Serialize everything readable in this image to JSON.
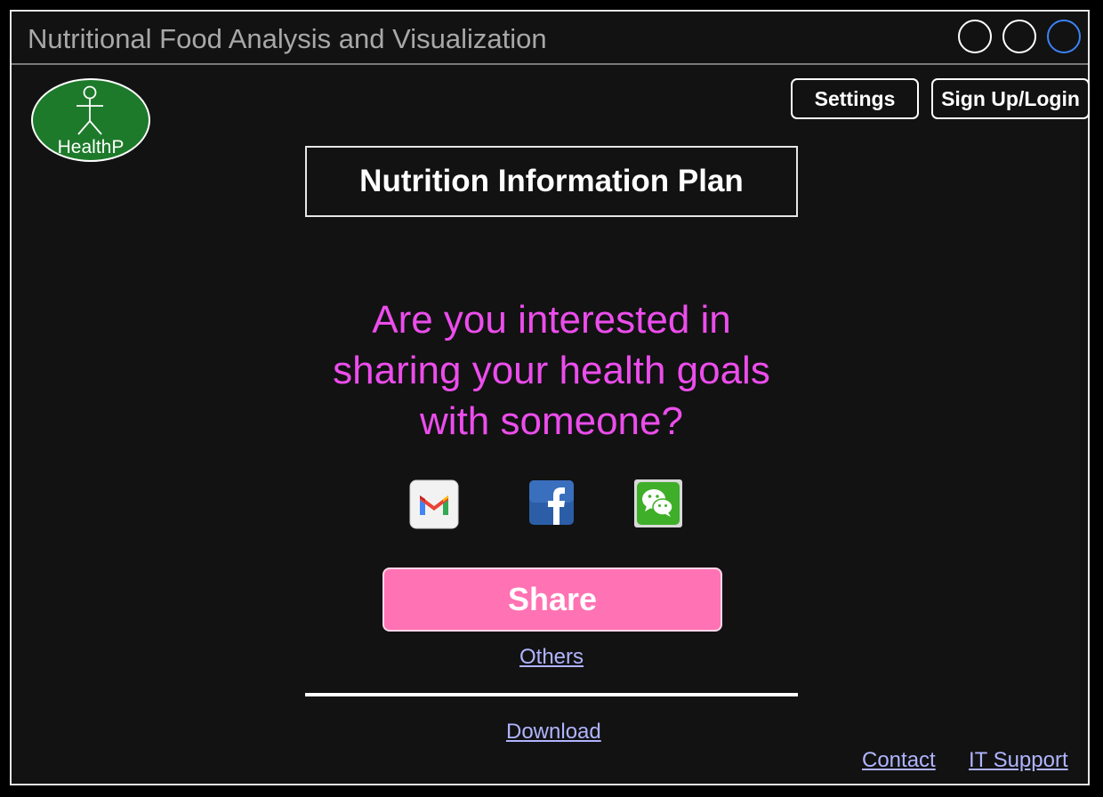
{
  "window": {
    "title": "Nutritional Food Analysis and Visualization",
    "controls": [
      "minimize",
      "maximize",
      "close"
    ]
  },
  "logo": {
    "text": "HealthP",
    "color": "#1d7a2a"
  },
  "header": {
    "settings_label": "Settings",
    "login_label": "Sign Up/Login"
  },
  "main": {
    "plan_title": "Nutrition Information Plan",
    "question_lines": [
      "Are you interested in",
      "sharing your health goals",
      "with someone?"
    ],
    "share_options": [
      "gmail-icon",
      "facebook-icon",
      "wechat-icon"
    ],
    "share_label": "Share",
    "others_label": "Others",
    "download_label": "Download"
  },
  "footer": {
    "contact_label": "Contact",
    "support_label": "IT Support"
  },
  "colors": {
    "accent_pink": "#ff72b3",
    "question_magenta": "#ec4dec",
    "link": "#b0b4ff",
    "background": "#121212"
  }
}
